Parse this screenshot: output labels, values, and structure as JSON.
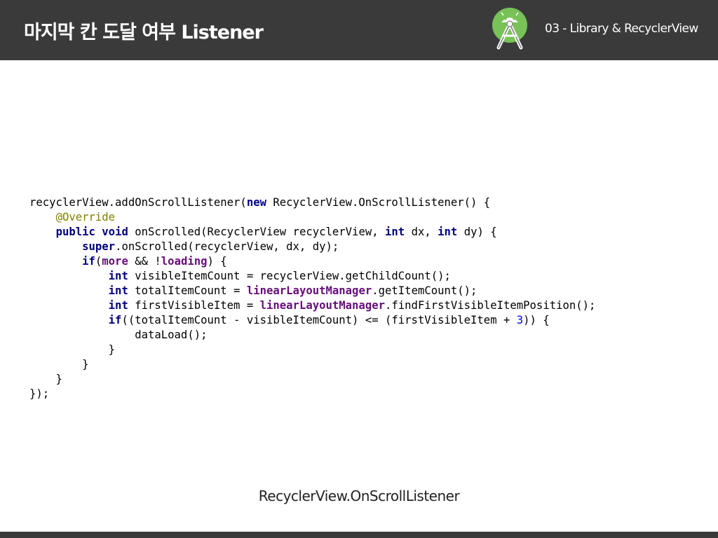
{
  "header": {
    "title": "마지막 칸 도달 여부 Listener",
    "section": "03 - Library & RecyclerView",
    "logo_icon": "android-studio-logo",
    "bg_color": "#3a3a3a"
  },
  "code": {
    "language": "java",
    "lines": [
      [
        {
          "t": "recyclerView.addOnScrollListener("
        },
        {
          "t": "new",
          "c": "kw"
        },
        {
          "t": " RecyclerView.OnScrollListener() {"
        }
      ],
      [
        {
          "t": "    "
        },
        {
          "t": "@Override",
          "c": "ann"
        }
      ],
      [
        {
          "t": "    "
        },
        {
          "t": "public",
          "c": "kw"
        },
        {
          "t": " "
        },
        {
          "t": "void",
          "c": "kw"
        },
        {
          "t": " onScrolled(RecyclerView recyclerView, "
        },
        {
          "t": "int",
          "c": "kw"
        },
        {
          "t": " dx, "
        },
        {
          "t": "int",
          "c": "kw"
        },
        {
          "t": " dy) {"
        }
      ],
      [
        {
          "t": "        "
        },
        {
          "t": "super",
          "c": "kw"
        },
        {
          "t": ".onScrolled(recyclerView, dx, dy);"
        }
      ],
      [
        {
          "t": "        "
        },
        {
          "t": "if",
          "c": "kw"
        },
        {
          "t": "("
        },
        {
          "t": "more",
          "c": "field"
        },
        {
          "t": " && !"
        },
        {
          "t": "loading",
          "c": "field"
        },
        {
          "t": ") {"
        }
      ],
      [
        {
          "t": "            "
        },
        {
          "t": "int",
          "c": "kw"
        },
        {
          "t": " visibleItemCount = recyclerView.getChildCount();"
        }
      ],
      [
        {
          "t": "            "
        },
        {
          "t": "int",
          "c": "kw"
        },
        {
          "t": " totalItemCount = "
        },
        {
          "t": "linearLayoutManager",
          "c": "field"
        },
        {
          "t": ".getItemCount();"
        }
      ],
      [
        {
          "t": "            "
        },
        {
          "t": "int",
          "c": "kw"
        },
        {
          "t": " firstVisibleItem = "
        },
        {
          "t": "linearLayoutManager",
          "c": "field"
        },
        {
          "t": ".findFirstVisibleItemPosition();"
        }
      ],
      [
        {
          "t": "            "
        },
        {
          "t": "if",
          "c": "kw"
        },
        {
          "t": "((totalItemCount - visibleItemCount) <= (firstVisibleItem + "
        },
        {
          "t": "3",
          "c": "num"
        },
        {
          "t": ")) {"
        }
      ],
      [
        {
          "t": "                dataLoad();"
        }
      ],
      [
        {
          "t": "            }"
        }
      ],
      [
        {
          "t": "        }"
        }
      ],
      [
        {
          "t": "    }"
        }
      ],
      [
        {
          "t": "});"
        }
      ]
    ]
  },
  "caption": "RecyclerView.OnScrollListener"
}
